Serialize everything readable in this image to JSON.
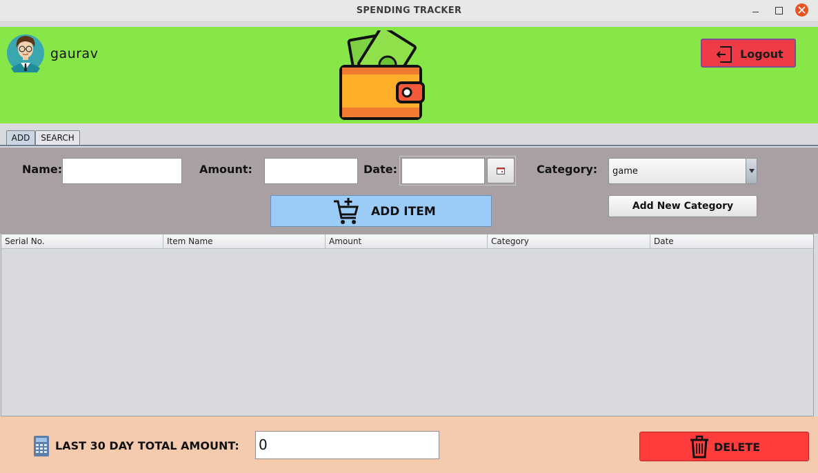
{
  "window": {
    "title": "SPENDING TRACKER"
  },
  "header": {
    "username": "gaurav",
    "logout_label": "Logout"
  },
  "tabs": [
    {
      "label": "ADD"
    },
    {
      "label": "SEARCH"
    }
  ],
  "form": {
    "name_label": "Name:",
    "name_value": "",
    "amount_label": "Amount:",
    "amount_value": "",
    "date_label": "Date:",
    "date_value": "",
    "category_label": "Category:",
    "category_selected": "game",
    "add_item_label": "ADD ITEM",
    "add_category_label": "Add New Category"
  },
  "table": {
    "columns": [
      "Serial No.",
      "Item Name",
      "Amount",
      "Category",
      "Date"
    ],
    "rows": []
  },
  "footer": {
    "total_label": "LAST 30 DAY TOTAL AMOUNT:",
    "total_value": "0",
    "delete_label": "DELETE"
  },
  "colors": {
    "header_bg": "#87e748",
    "form_bg": "#a9a0a3",
    "footer_bg": "#f6cbad",
    "logout_bg": "#ef3b45",
    "add_item_bg": "#9bcbf7",
    "delete_bg": "#ff3c3c"
  }
}
